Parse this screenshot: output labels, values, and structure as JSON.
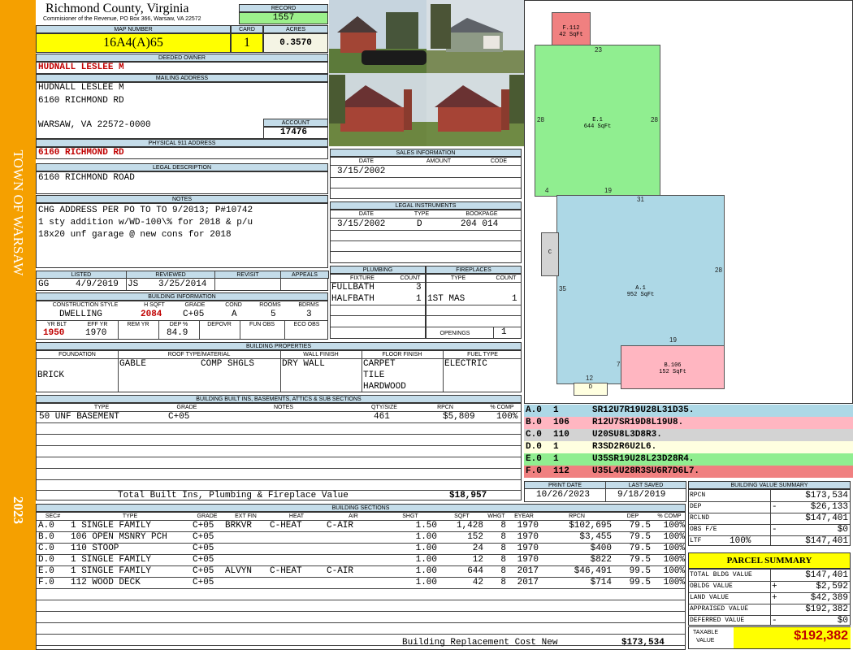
{
  "side": {
    "town": "TOWN OF WARSAW",
    "year": "2023"
  },
  "header": {
    "county": "Richmond County, Virginia",
    "commissioner": "Commisioner of the Revenue, PO Box 366, Warsaw, VA 22572",
    "record_label": "RECORD",
    "record": "1557",
    "map_label": "MAP NUMBER",
    "map": "16A4(A)65",
    "card_label": "CARD",
    "card": "1",
    "acres_label": "ACRES",
    "acres": "0.3570"
  },
  "owner": {
    "deeded_label": "DEEDED OWNER",
    "deeded": "HUDNALL LESLEE M",
    "mailing_label": "MAILING ADDRESS",
    "mail1": "HUDNALL LESLEE M",
    "mail2": "6160 RICHMOND RD",
    "mail3": "WARSAW, VA 22572-0000",
    "account_label": "ACCOUNT",
    "account": "17476",
    "p911_label": "PHYSICAL 911 ADDRESS",
    "p911": "6160 RICHMOND RD"
  },
  "legal": {
    "label": "LEGAL DESCRIPTION",
    "text": "6160 RICHMOND ROAD"
  },
  "notes": {
    "label": "NOTES",
    "l1": "CHG ADDRESS PER PO TO TO 9/2013; P#10742",
    "l2": "1 sty addition w/WD-100\\% for 2018 & p/u",
    "l3": "18x20 unf garage @ new cons for 2018"
  },
  "listed": {
    "listed_label": "LISTED",
    "reviewed_label": "REVIEWED",
    "revisit_label": "REVISIT",
    "appeals_label": "APPEALS",
    "lby": "GG",
    "ldate": "4/9/2019",
    "rby": "JS",
    "rdate": "3/25/2014"
  },
  "bldg": {
    "label": "BUILDING INFORMATION",
    "h": [
      "CONSTRUCTION STYLE",
      "H SQFT",
      "GRADE",
      "COND",
      "ROOMS",
      "BDRMS"
    ],
    "v": [
      "DWELLING",
      "2084",
      "C+05",
      "A",
      "5",
      "3"
    ],
    "h2": [
      "YR BLT",
      "EFF YR",
      "REM YR",
      "DEP %",
      "DEPOVR",
      "FUN OBS",
      "ECO OBS"
    ],
    "v2": [
      "1950",
      "1970",
      "",
      "84.9",
      "",
      "",
      ""
    ]
  },
  "sales": {
    "label": "SALES INFORMATION",
    "h": [
      "DATE",
      "AMOUNT",
      "CODE"
    ],
    "date": "3/15/2002"
  },
  "instruments": {
    "label": "LEGAL INSTRUMENTS",
    "h": [
      "DATE",
      "TYPE",
      "BOOKPAGE"
    ],
    "date": "3/15/2002",
    "type": "D",
    "book": "204 014"
  },
  "plumbing": {
    "label": "PLUMBING",
    "h": [
      "FIXTURE",
      "COUNT"
    ],
    "r1": "FULLBATH",
    "c1": "3",
    "r2": "HALFBATH",
    "c2": "1"
  },
  "fire": {
    "label": "FIREPLACES",
    "h": [
      "TYPE",
      "COUNT"
    ],
    "r1": "1ST MAS",
    "c1": "1",
    "open_label": "OPENINGS",
    "open": "1"
  },
  "props": {
    "label": "BUILDING PROPERTIES",
    "h": [
      "FOUNDATION",
      "ROOF TYPE/MATERIAL",
      "WALL FINISH",
      "FLOOR FINISH",
      "FUEL TYPE"
    ],
    "found": "BRICK",
    "roof1": "GABLE",
    "roof2": "COMP SHGLS",
    "wall": "DRY WALL",
    "floor1": "CARPET",
    "floor2": "TILE",
    "floor3": "HARDWOOD",
    "fuel": "ELECTRIC"
  },
  "builtins": {
    "label": "BUILDING BUILT INS, BASEMENTS, ATTICS & SUB SECTIONS",
    "h": [
      "TYPE",
      "GRADE",
      "NOTES",
      "QTY/SIZE",
      "RPCN",
      "% COMP"
    ],
    "row": [
      "50 UNF BASEMENT",
      "C+05",
      "",
      "461",
      "$5,809",
      "100%"
    ],
    "total_label": "Total Built Ins, Plumbing & Fireplace Value",
    "total": "$18,957"
  },
  "sketch": {
    "labels": [
      "F.112",
      "42 SqFt",
      "E.1",
      "644 SqFt",
      "A.1",
      "952 SqFt",
      "B.106",
      "152 SqFt",
      "C",
      "D"
    ],
    "dims": [
      "23",
      "28",
      "28",
      "4",
      "19",
      "31",
      "35",
      "28",
      "19",
      "7",
      "12"
    ],
    "colors": {
      "a": "#add8e6",
      "b": "#ffb6c1",
      "e": "#90ee90",
      "f": "#f08080",
      "c": "#d3d3d3",
      "d": "#ffffe0"
    }
  },
  "legend": [
    {
      "code": "A.0",
      "n": "1",
      "desc": "SR12U7R19U28L31D35.",
      "color": "#add8e6"
    },
    {
      "code": "B.0",
      "n": "106",
      "desc": "R12U7SR19D8L19U8.",
      "color": "#ffb6c1"
    },
    {
      "code": "C.0",
      "n": "110",
      "desc": "U20SU8L3D8R3.",
      "color": "#d3d3d3"
    },
    {
      "code": "D.0",
      "n": "1",
      "desc": "R3SD2R6U2L6.",
      "color": "#ffffe0"
    },
    {
      "code": "E.0",
      "n": "1",
      "desc": "U35SR19U28L23D28R4.",
      "color": "#90ee90"
    },
    {
      "code": "F.0",
      "n": "112",
      "desc": "U35L4U28R3SU6R7D6L7.",
      "color": "#f08080"
    }
  ],
  "print": {
    "print_label": "PRINT DATE",
    "saved_label": "LAST SAVED",
    "print": "10/26/2023",
    "saved": "9/18/2019"
  },
  "sections": {
    "label": "BUILDING SECTIONS",
    "h": [
      "SEC#",
      "TYPE",
      "GRADE",
      "EXT FIN",
      "HEAT",
      "AIR",
      "SHGT",
      "SQFT",
      "WHGT",
      "EYEAR",
      "RPCN",
      "DEP",
      "% COMP"
    ],
    "rows": [
      [
        "A.0",
        "1 SINGLE FAMILY",
        "C+05",
        "BRKVR",
        "C-HEAT",
        "C-AIR",
        "1.50",
        "1,428",
        "8",
        "1970",
        "$102,695",
        "79.5",
        "100%"
      ],
      [
        "B.0",
        "106 OPEN MSNRY PCH",
        "C+05",
        "",
        "",
        "",
        "1.00",
        "152",
        "8",
        "1970",
        "$3,455",
        "79.5",
        "100%"
      ],
      [
        "C.0",
        "110 STOOP",
        "C+05",
        "",
        "",
        "",
        "1.00",
        "24",
        "8",
        "1970",
        "$400",
        "79.5",
        "100%"
      ],
      [
        "D.0",
        "1 SINGLE FAMILY",
        "C+05",
        "",
        "",
        "",
        "1.00",
        "12",
        "8",
        "1970",
        "$822",
        "79.5",
        "100%"
      ],
      [
        "E.0",
        "1 SINGLE FAMILY",
        "C+05",
        "ALVYN",
        "C-HEAT",
        "C-AIR",
        "1.00",
        "644",
        "8",
        "2017",
        "$46,491",
        "99.5",
        "100%"
      ],
      [
        "F.0",
        "112 WOOD DECK",
        "C+05",
        "",
        "",
        "",
        "1.00",
        "42",
        "8",
        "2017",
        "$714",
        "99.5",
        "100%"
      ]
    ],
    "total_label": "Building Replacement Cost New",
    "total": "$173,534"
  },
  "bvs": {
    "label": "BUILDING VALUE SUMMARY",
    "rows": [
      {
        "k": "RPCN",
        "s": "",
        "v": "$173,534"
      },
      {
        "k": "DEP",
        "s": "-",
        "v": "$26,133"
      },
      {
        "k": "RCLND",
        "s": "",
        "v": "$147,401"
      },
      {
        "k": "OBS F/E",
        "s": "-",
        "v": "$0"
      },
      {
        "k": "LTF",
        "s": "100%",
        "v": "$147,401"
      }
    ]
  },
  "parcel": {
    "label": "PARCEL SUMMARY",
    "rows": [
      {
        "k": "TOTAL BLDG VALUE",
        "s": "",
        "v": "$147,401"
      },
      {
        "k": "OBLDG VALUE",
        "s": "+",
        "v": "$2,592"
      },
      {
        "k": "LAND VALUE",
        "s": "+",
        "v": "$42,389"
      },
      {
        "k": "APPRAISED VALUE",
        "s": "",
        "v": "$192,382"
      },
      {
        "k": "DEFERRED VALUE",
        "s": "-",
        "v": "$0"
      }
    ],
    "taxable_label1": "TAXABLE",
    "taxable_label2": "VALUE",
    "taxable": "$192,382"
  }
}
